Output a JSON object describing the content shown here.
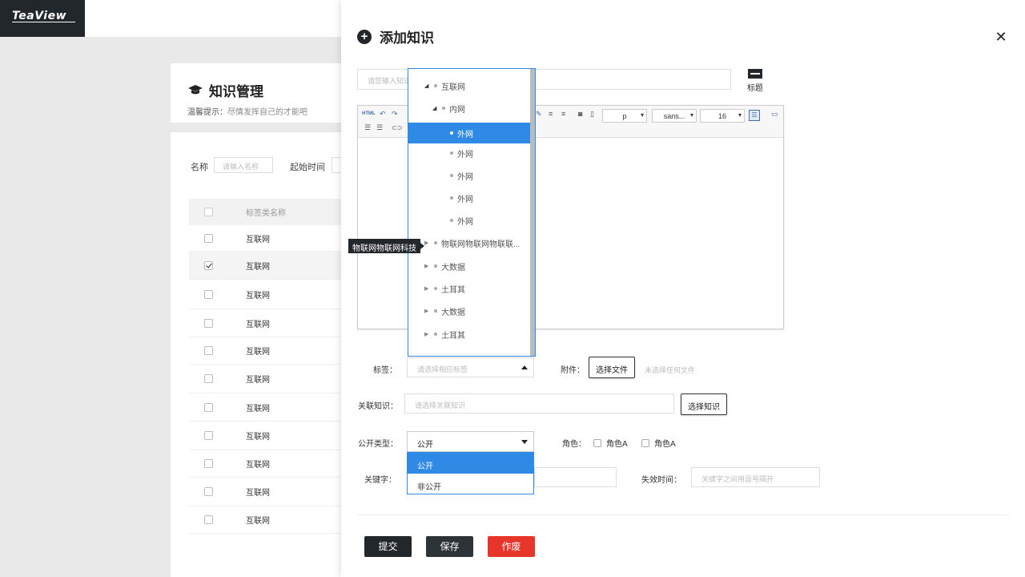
{
  "app": {
    "logo": "TeaView"
  },
  "background_page": {
    "title": "知识管理",
    "hint_label": "温馨提示：",
    "hint_text": "尽情发挥自己的才能吧",
    "filter_name_label": "名称",
    "filter_name_placeholder": "请输入名称",
    "filter_start_label": "起始时间",
    "table_header": "标签类名称",
    "rows": [
      "互联网",
      "互联网",
      "互联网",
      "互联网",
      "互联网",
      "互联网",
      "互联网",
      "互联网",
      "互联网",
      "互联网",
      "互联网"
    ],
    "checked_row_index": 1
  },
  "drawer": {
    "title": "添加知识",
    "title_input_placeholder": "请您输入知识",
    "heading_btn_label": "标题",
    "toolbar": {
      "html": "HTML",
      "para_select": "p",
      "font_select": "sans...",
      "size_select": "16"
    },
    "tag_label": "标签：",
    "tag_placeholder": "请选择相应标签",
    "attach_label": "附件：",
    "choose_file_btn": "选择文件",
    "no_file_text": "未选择任何文件",
    "related_label": "关联知识：",
    "related_placeholder": "请选择关联知识",
    "choose_knowledge_btn": "选择知识",
    "public_type_label": "公开类型：",
    "public_type_value": "公开",
    "public_type_options": [
      "公开",
      "非公开"
    ],
    "role_label": "角色：",
    "roles": [
      "角色A",
      "角色A"
    ],
    "keyword_label": "关键字：",
    "expire_label": "失效时间：",
    "expire_placeholder": "关键字之间用逗号隔开",
    "submit_btn": "提交",
    "save_btn": "保存",
    "discard_btn": "作废",
    "colors": {
      "primary": "#22272b",
      "accent": "#2f8ae5",
      "danger": "#e8352b"
    }
  },
  "tree": {
    "nodes": [
      {
        "label": "互联网",
        "level": 0,
        "expanded": true
      },
      {
        "label": "内网",
        "level": 1,
        "expanded": true
      },
      {
        "label": "外网",
        "level": 2,
        "selected": true
      },
      {
        "label": "外网",
        "level": 2
      },
      {
        "label": "外网",
        "level": 2
      },
      {
        "label": "外网",
        "level": 2
      },
      {
        "label": "外网",
        "level": 2
      },
      {
        "label": "物联网物联网物联联...",
        "level": 0,
        "collapsed": true
      },
      {
        "label": "大数据",
        "level": 0,
        "collapsed": true
      },
      {
        "label": "土耳其",
        "level": 0,
        "collapsed": true
      },
      {
        "label": "大数据",
        "level": 0,
        "collapsed": true
      },
      {
        "label": "土耳其",
        "level": 0,
        "collapsed": true
      }
    ],
    "tooltip": "物联网物联网科技"
  }
}
